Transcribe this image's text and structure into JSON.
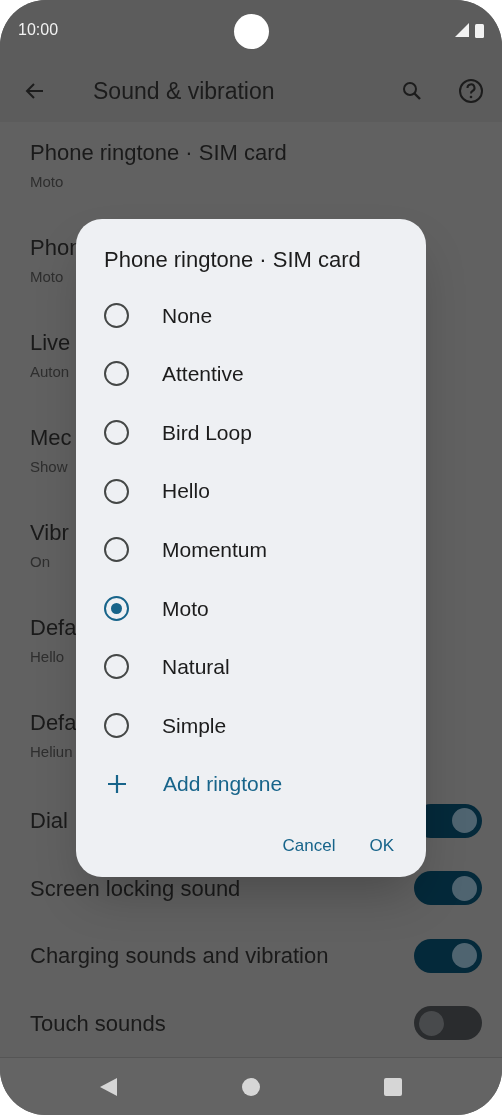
{
  "status_bar": {
    "time": "10:00"
  },
  "app_bar": {
    "title": "Sound & vibration"
  },
  "settings": [
    {
      "kind": "two_line",
      "title": "Phone ringtone · SIM card",
      "subtitle": "Moto"
    },
    {
      "kind": "two_line",
      "title": "Phon",
      "subtitle": "Moto"
    },
    {
      "kind": "two_line",
      "title": "Live",
      "subtitle": "Auton"
    },
    {
      "kind": "two_line",
      "title": "Mec",
      "subtitle": "Show"
    },
    {
      "kind": "two_line",
      "title": "Vibr",
      "subtitle": "On"
    },
    {
      "kind": "two_line",
      "title": "Defa",
      "subtitle": "Hello"
    },
    {
      "kind": "two_line",
      "title": "Defa",
      "subtitle": "Heliun"
    },
    {
      "kind": "switch",
      "title": "Dial",
      "on": true
    },
    {
      "kind": "switch",
      "title": "Screen locking sound",
      "on": true
    },
    {
      "kind": "switch",
      "title": "Charging sounds and vibration",
      "on": true
    },
    {
      "kind": "switch",
      "title": "Touch sounds",
      "on": false
    }
  ],
  "dialog": {
    "title": "Phone ringtone · SIM card",
    "options": [
      {
        "label": "None",
        "selected": false
      },
      {
        "label": "Attentive",
        "selected": false
      },
      {
        "label": "Bird Loop",
        "selected": false
      },
      {
        "label": "Hello",
        "selected": false
      },
      {
        "label": "Momentum",
        "selected": false
      },
      {
        "label": "Moto",
        "selected": true
      },
      {
        "label": "Natural",
        "selected": false
      },
      {
        "label": "Simple",
        "selected": false
      }
    ],
    "add": "Add ringtone",
    "buttons": [
      "Cancel",
      "OK"
    ]
  }
}
